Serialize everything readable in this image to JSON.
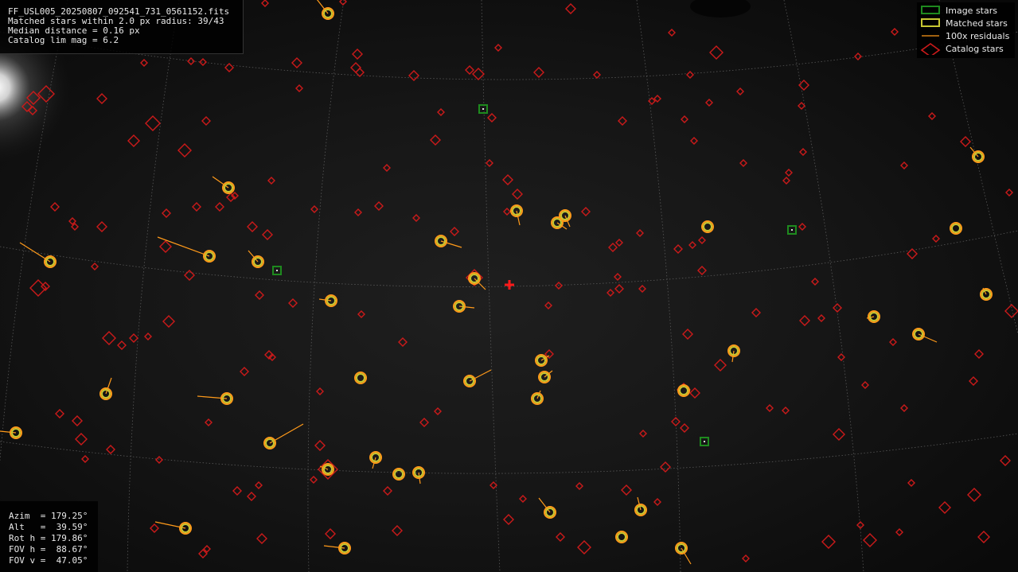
{
  "info": {
    "filename": "FF_USL005_20250807_092541_731_0561152.fits",
    "matched": "Matched stars within 2.0 px radius: 39/43",
    "median": "Median distance = 0.16 px",
    "limmag": "Catalog lim mag = 6.2"
  },
  "pointing": {
    "azim": "Azim  = 179.25°",
    "alt": "Alt   =  39.59°",
    "roth": "Rot h = 179.86°",
    "fovh": "FOV h =  88.67°",
    "fovv": "FOV v =  47.05°"
  },
  "legend": {
    "image_stars": "Image stars",
    "matched_stars": "Matched stars",
    "residuals": "100x residuals",
    "catalog_stars": "Catalog stars"
  },
  "colors": {
    "image_star": "#1e8a1e",
    "matched_star": "#c8c832",
    "residual": "#ff9a1a",
    "catalog_star": "#cc1a1a",
    "center_marker": "#ff1a1a",
    "grid": "#6a6a6a"
  },
  "icons": {
    "center": "red-plus-icon",
    "image_star": "green-square-icon",
    "matched_star": "yellow-circle-icon",
    "catalog_star": "red-diamond-icon"
  }
}
